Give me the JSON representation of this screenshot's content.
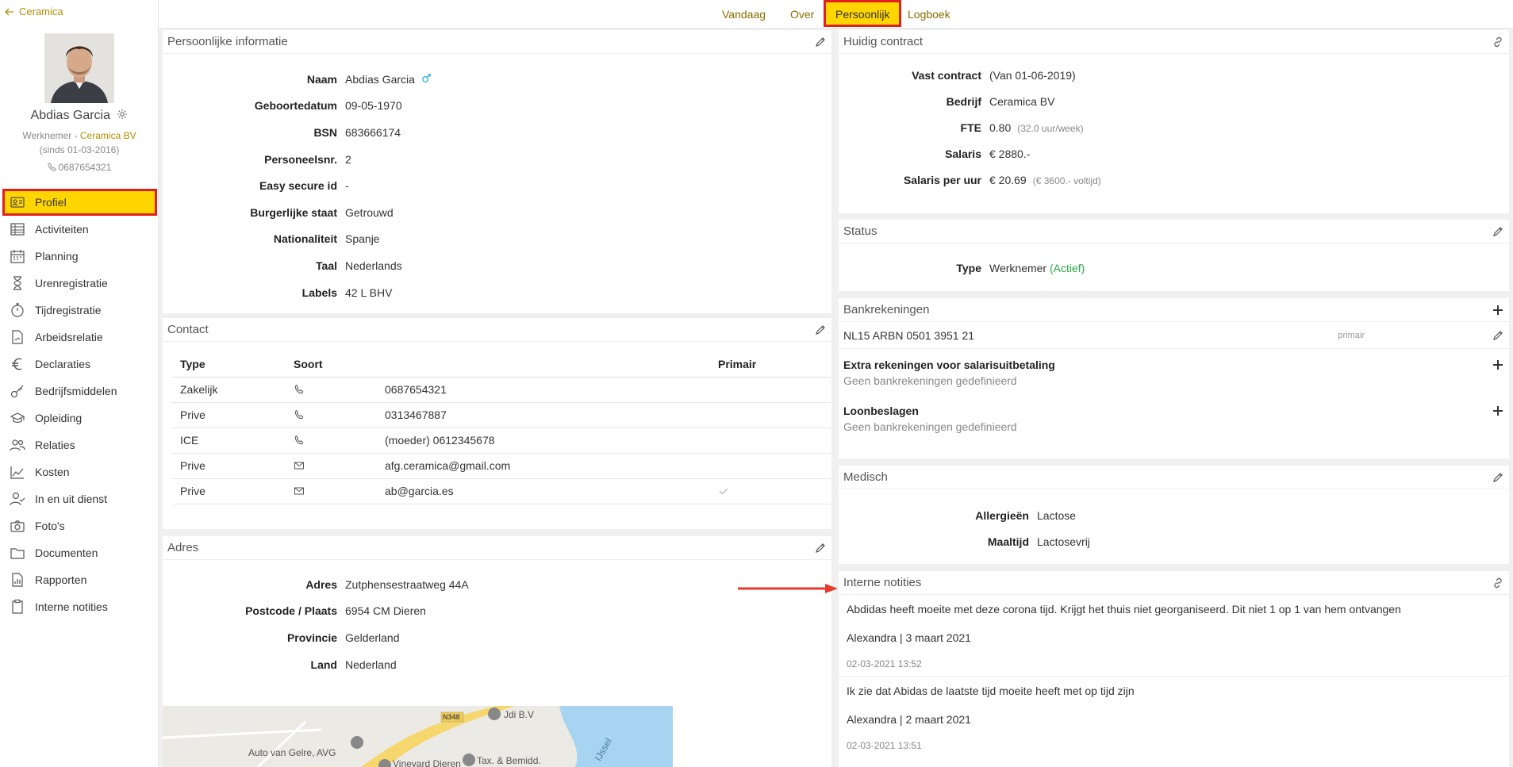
{
  "sidebar": {
    "back_label": "Ceramica",
    "profile": {
      "name": "Abdias Garcia",
      "role_prefix": "Werknemer - ",
      "company": "Ceramica BV",
      "since": "(sinds 01-03-2016)",
      "phone": "0687654321"
    },
    "items": [
      {
        "label": "Profiel",
        "icon": "id-card-icon"
      },
      {
        "label": "Activiteiten",
        "icon": "table-icon"
      },
      {
        "label": "Planning",
        "icon": "calendar-icon"
      },
      {
        "label": "Urenregistratie",
        "icon": "hourglass-icon"
      },
      {
        "label": "Tijdregistratie",
        "icon": "stopwatch-icon"
      },
      {
        "label": "Arbeidsrelatie",
        "icon": "document-icon"
      },
      {
        "label": "Declaraties",
        "icon": "euro-icon"
      },
      {
        "label": "Bedrijfsmiddelen",
        "icon": "key-icon"
      },
      {
        "label": "Opleiding",
        "icon": "graduation-icon"
      },
      {
        "label": "Relaties",
        "icon": "people-icon"
      },
      {
        "label": "Kosten",
        "icon": "chart-icon"
      },
      {
        "label": "In en uit dienst",
        "icon": "user-check-icon"
      },
      {
        "label": "Foto's",
        "icon": "camera-icon"
      },
      {
        "label": "Documenten",
        "icon": "folder-icon"
      },
      {
        "label": "Rapporten",
        "icon": "report-icon"
      },
      {
        "label": "Interne notities",
        "icon": "clipboard-icon"
      }
    ]
  },
  "tabs": [
    "Vandaag",
    "Over",
    "Persoonlijk",
    "Logboek"
  ],
  "personal": {
    "title": "Persoonlijke informatie",
    "rows": [
      {
        "k": "Naam",
        "v": "Abdias Garcia"
      },
      {
        "k": "Geboortedatum",
        "v": "09-05-1970"
      },
      {
        "k": "BSN",
        "v": "683666174"
      },
      {
        "k": "Personeelsnr.",
        "v": "2"
      },
      {
        "k": "Easy secure id",
        "v": "-"
      },
      {
        "k": "Burgerlijke staat",
        "v": "Getrouwd"
      },
      {
        "k": "Nationaliteit",
        "v": "Spanje"
      },
      {
        "k": "Taal",
        "v": "Nederlands"
      },
      {
        "k": "Labels",
        "v": "42 L BHV"
      }
    ]
  },
  "contact": {
    "title": "Contact",
    "headers": [
      "Type",
      "Soort",
      "",
      "Primair"
    ],
    "rows": [
      {
        "type": "Zakelijk",
        "kind": "phone",
        "value": "0687654321",
        "primary": ""
      },
      {
        "type": "Prive",
        "kind": "phone",
        "value": "0313467887",
        "primary": ""
      },
      {
        "type": "ICE",
        "kind": "phone",
        "value": "(moeder) 0612345678",
        "primary": ""
      },
      {
        "type": "Prive",
        "kind": "mail",
        "value": "afg.ceramica@gmail.com",
        "primary": ""
      },
      {
        "type": "Prive",
        "kind": "mail",
        "value": "ab@garcia.es",
        "primary": "check"
      }
    ]
  },
  "address": {
    "title": "Adres",
    "rows": [
      {
        "k": "Adres",
        "v": "Zutphensestraatweg 44A"
      },
      {
        "k": "Postcode / Plaats",
        "v": "6954 CM Dieren"
      },
      {
        "k": "Provincie",
        "v": "Gelderland"
      },
      {
        "k": "Land",
        "v": "Nederland"
      }
    ],
    "map_labels": [
      "Auto van Gelre, AVG",
      "Jdi B.V",
      "N348",
      "Tax. & Bemidd.",
      "Vineyard Dieren",
      "IJssel"
    ]
  },
  "contract": {
    "title": "Huidig contract",
    "rows": [
      {
        "k": "Vast contract",
        "v": "(Van 01-06-2019)",
        "sub": ""
      },
      {
        "k": "Bedrijf",
        "v": "Ceramica BV",
        "sub": ""
      },
      {
        "k": "FTE",
        "v": "0.80",
        "sub": "(32.0 uur/week)"
      },
      {
        "k": "Salaris",
        "v": "€ 2880.-",
        "sub": ""
      },
      {
        "k": "Salaris per uur",
        "v": "€ 20.69",
        "sub": "(€ 3600.- voltijd)"
      }
    ]
  },
  "status": {
    "title": "Status",
    "k": "Type",
    "v": "Werknemer",
    "state": "(Actief)"
  },
  "bank": {
    "title": "Bankrekeningen",
    "account": "NL15 ARBN 0501 3951 21",
    "primary": "primair",
    "extra_title": "Extra rekeningen voor salarisuitbetaling",
    "extra_none": "Geen bankrekeningen gedefinieerd",
    "garnish_title": "Loonbeslagen",
    "garnish_none": "Geen bankrekeningen gedefinieerd"
  },
  "medical": {
    "title": "Medisch",
    "rows": [
      {
        "k": "Allergieën",
        "v": "Lactose"
      },
      {
        "k": "Maaltijd",
        "v": "Lactosevrij"
      }
    ]
  },
  "notes": {
    "title": "Interne notities",
    "items": [
      {
        "text": "Abdidas heeft moeite met deze corona tijd. Krijgt het thuis niet georganiseerd. Dit niet 1 op 1 van hem ontvangen",
        "author": "Alexandra | 3 maart 2021",
        "date": "02-03-2021 13:52"
      },
      {
        "text": "Ik zie dat Abidas de laatste tijd moeite heeft met op tijd zijn",
        "author": "Alexandra | 2 maart 2021",
        "date": "02-03-2021 13:51"
      }
    ]
  },
  "colors": {
    "accent": "#ffd500",
    "highlight": "#e02020",
    "link": "#b38f00",
    "active_green": "#2aa84a"
  }
}
